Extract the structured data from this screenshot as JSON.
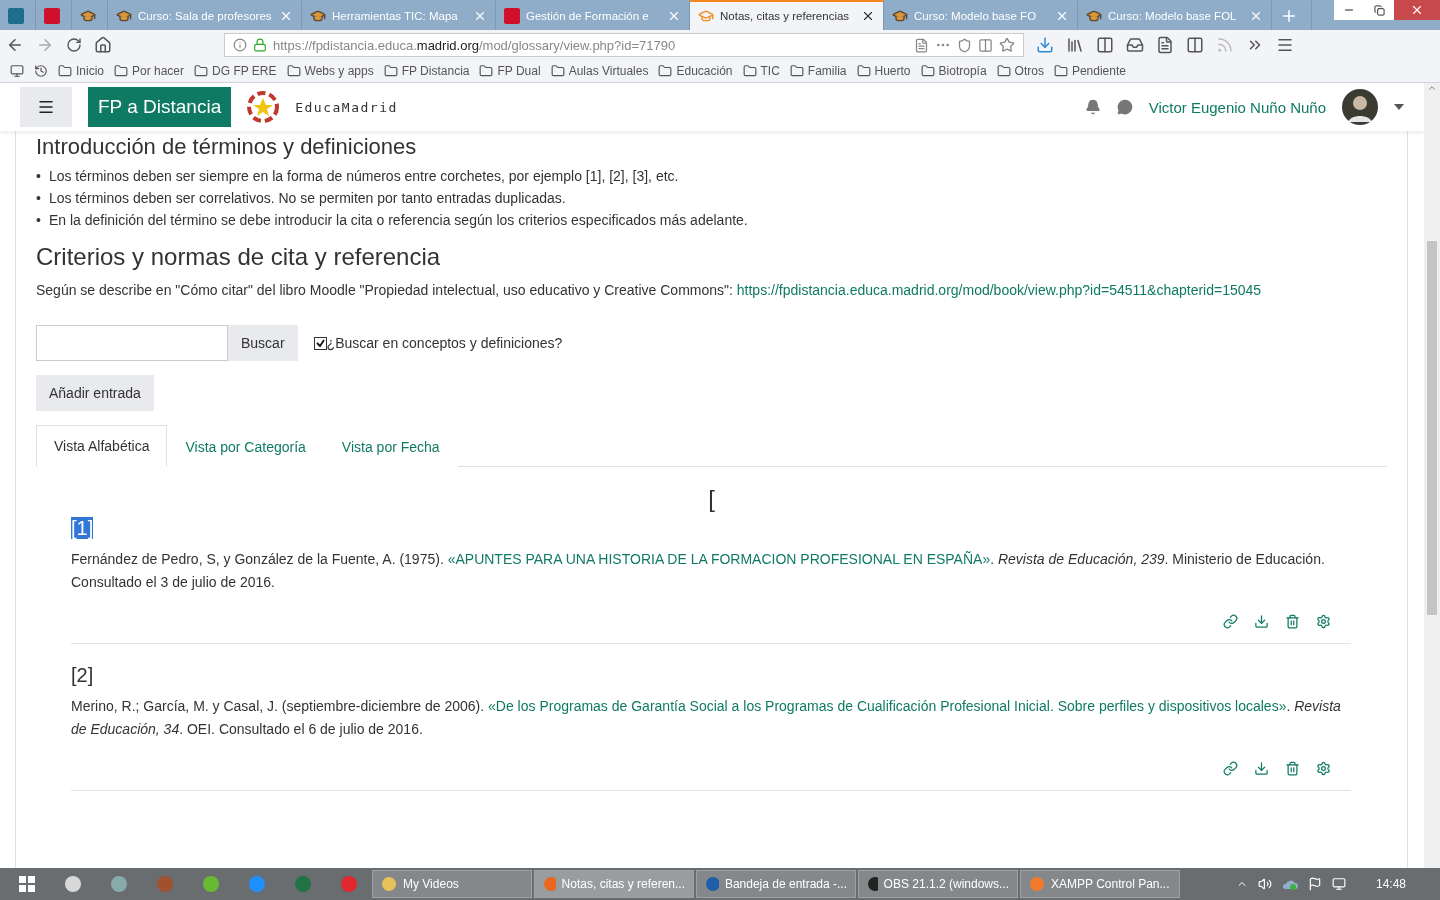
{
  "browser_tabs": [
    {
      "selected": false
    },
    {
      "selected": false
    },
    {
      "selected": false
    },
    {
      "label": "Curso: Sala de profesores",
      "selected": false
    },
    {
      "label": "Herramientas TIC: Mapa",
      "selected": false
    },
    {
      "label": "Gestión de Formación e",
      "selected": false
    },
    {
      "label": "Notas, citas y referencias",
      "selected": true
    },
    {
      "label": "Curso: Modelo base FO",
      "selected": false
    },
    {
      "label": "Curso: Modelo base FOL",
      "selected": false
    }
  ],
  "address_bar": {
    "url": "https://fpdistancia.educa.**madrid.org**/mod/glossary/view.php?id=71790"
  },
  "bookmarks": [
    {
      "label": "Inicio"
    },
    {
      "label": "Por hacer"
    },
    {
      "label": "DG FP ERE"
    },
    {
      "label": "Webs y apps"
    },
    {
      "label": "FP Distancia"
    },
    {
      "label": "FP Dual"
    },
    {
      "label": "Aulas Virtuales"
    },
    {
      "label": "Educación"
    },
    {
      "label": "TIC"
    },
    {
      "label": "Familia"
    },
    {
      "label": "Huerto"
    },
    {
      "label": "Biotropía"
    },
    {
      "label": "Otros"
    },
    {
      "label": "Pendiente"
    }
  ],
  "site_header": {
    "brand": "FP a Distancia",
    "logo_text": "EducaMadrid",
    "user_name": "Victor Eugenio Nuño Nuño"
  },
  "content": {
    "partial_heading": "Introducción de términos y definiciones",
    "bullets": [
      {
        "marker": "•",
        "text": "Los términos deben ser siempre en la forma de números entre corchetes, por ejemplo [1], [2], [3], etc."
      },
      {
        "marker": "•",
        "text": "Los términos deben ser correlativos. No se permiten por tanto entradas duplicadas."
      },
      {
        "marker": "•",
        "text": "En la definición del término se debe introducir la cita o referencia según los criterios especificados más adelante."
      }
    ],
    "heading": "Criterios y normas de cita y referencia",
    "paragraph": "Según se describe en \"Cómo citar\" del libro Moodle \"Propiedad intelectual, uso educativo y Creative Commons\": ",
    "paragraph_link": "https://fpdistancia.educa.madrid.org/mod/book/view.php?id=54511&chapterid=15045",
    "search": {
      "button": "Buscar",
      "checkbox_label": "¿Buscar en conceptos y definiciones?",
      "checked": true
    },
    "add_button": "Añadir entrada",
    "view_tabs": [
      {
        "label": "Vista Alfabética",
        "selected": true
      },
      {
        "label": "Vista por Categoría",
        "selected": false
      },
      {
        "label": "Vista por Fecha",
        "selected": false
      }
    ],
    "letter": "[",
    "entries": [
      {
        "term": "[1]",
        "highlighted": true,
        "text_before": "Fernández de Pedro, S, y González de la Fuente, A. (1975). ",
        "link": "«APUNTES PARA UNA HISTORIA DE LA FORMACION PROFESIONAL EN ESPAÑA»",
        "text_after": ". *Revista de Educación, 239*. Ministerio de Educación. Consultado el 3 de julio de 2016."
      },
      {
        "term": "[2]",
        "highlighted": false,
        "text_before": "Merino, R.; García, M. y Casal, J. (septiembre-diciembre de 2006). ",
        "link": "«De los Programas de Garantía Social a los Programas de Cualificación Profesional Inicial. Sobre perfiles y dispositivos locales»",
        "text_after": ". *Revista de Educación, 34*. OEI. Consultado el 6 de julio de 2016."
      }
    ]
  },
  "taskbar": {
    "windows": [
      {
        "label": "My Videos",
        "selected": false
      },
      {
        "label": "Notas, citas y referen...",
        "selected": true
      },
      {
        "label": "Bandeja de entrada -...",
        "selected": false
      },
      {
        "label": "OBS 21.1.2 (windows...",
        "selected": false
      },
      {
        "label": "XAMPP Control Pan...",
        "selected": false
      }
    ],
    "clock": "14:48"
  }
}
